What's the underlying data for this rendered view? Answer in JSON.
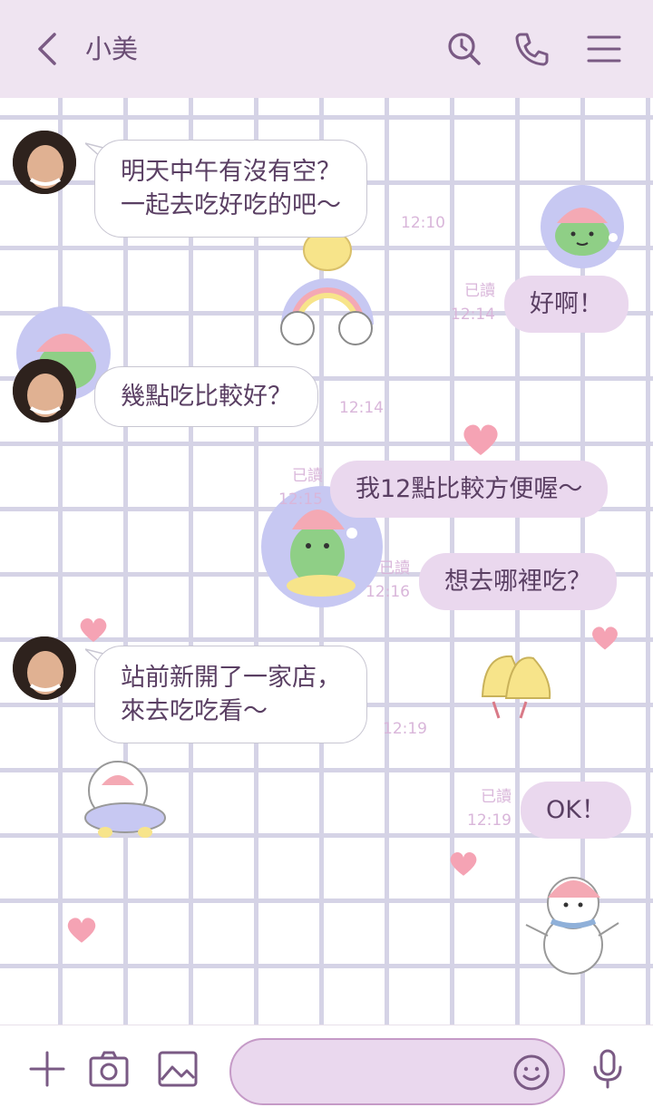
{
  "header": {
    "title": "小美",
    "back_icon": "chevron-left-icon",
    "icons": [
      "search-icon",
      "phone-icon",
      "menu-icon"
    ]
  },
  "messages": [
    {
      "side": "in",
      "lines": [
        "明天中午有沒有空？",
        "一起去吃好吃的吧～"
      ],
      "time": "12:10"
    },
    {
      "side": "out",
      "text": "好啊！",
      "read": "已讀",
      "time": "12:14"
    },
    {
      "side": "in",
      "lines": [
        "幾點吃比較好？"
      ],
      "time": "12:14"
    },
    {
      "side": "out",
      "text": "我12點比較方便喔～",
      "read": "已讀",
      "time": "12:15"
    },
    {
      "side": "out",
      "text": "想去哪裡吃？",
      "read": "已讀",
      "time": "12:16"
    },
    {
      "side": "in",
      "lines": [
        "站前新開了一家店，",
        "來去吃吃看～"
      ],
      "time": "12:19"
    },
    {
      "side": "out",
      "text": "OK！",
      "read": "已讀",
      "time": "12:19"
    }
  ],
  "footer": {
    "icons": [
      "plus-icon",
      "camera-icon",
      "image-icon",
      "emoji-icon",
      "microphone-icon"
    ],
    "input_placeholder": ""
  },
  "colors": {
    "header_bg": "#efe4f1",
    "accent": "#6a4d74",
    "out_bubble": "#ead8ee",
    "meta_text": "#d9b6da"
  }
}
